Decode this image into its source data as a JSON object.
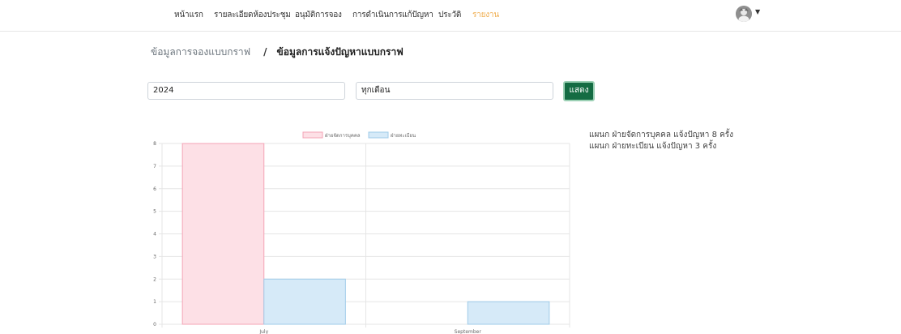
{
  "nav": {
    "items": [
      {
        "label": "หน้าแรก",
        "active": false
      },
      {
        "label": "รายละเอียดห้องประชุม",
        "active": false
      },
      {
        "label": "อนุมัติการจอง",
        "active": false
      },
      {
        "label": "การดำเนินการแก้ปัญหา",
        "active": false
      },
      {
        "label": "ประวัติ",
        "active": false
      },
      {
        "label": "รายงาน",
        "active": true
      }
    ],
    "avatar_icon": "user-avatar",
    "caret_icon": "caret-down-icon"
  },
  "breadcrumb": {
    "link": "ข้อมูลการจองแบบกราฟ",
    "separator": "/",
    "current": "ข้อมูลการแจ้งปัญหาแบบกราฟ"
  },
  "filters": {
    "year_value": "2024",
    "month_value": "ทุกเดือน",
    "show_label": "แสดง"
  },
  "summary": [
    "แผนก ฝ่ายจัดการบุคคล แจ้งปัญหา 8 ครั้ง",
    "แผนก ฝ่ายทะเบียน แจ้งปัญหา 3 ครั้ง"
  ],
  "colors": {
    "accent_active": "#f0ad4e",
    "button": "#146c43",
    "series1_fill": "#fde0e6",
    "series1_stroke": "#f4a3b5",
    "series2_fill": "#d6eaf8",
    "series2_stroke": "#9fcbe8"
  },
  "chart_data": {
    "type": "bar",
    "categories": [
      "July",
      "September"
    ],
    "series": [
      {
        "name": "ฝ่ายจัดการบุคคล",
        "values": [
          8,
          0
        ]
      },
      {
        "name": "ฝ่ายทะเบียน",
        "values": [
          2,
          1
        ]
      }
    ],
    "ylim": [
      0,
      8
    ],
    "yticks": [
      "0",
      "1",
      "2",
      "3",
      "4",
      "5",
      "6",
      "7",
      "8"
    ],
    "grid": true,
    "legend": "top"
  }
}
